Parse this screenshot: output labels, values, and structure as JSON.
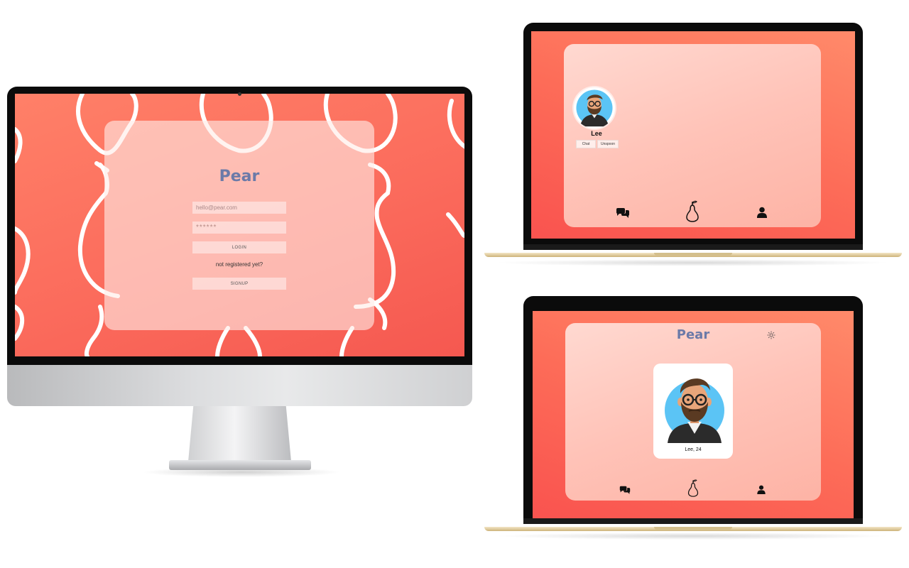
{
  "login_screen": {
    "app_title": "Pear",
    "email_placeholder": "hello@pear.com",
    "password_masked": "******",
    "login_label": "LOGIN",
    "note": "not registered yet?",
    "signup_label": "SIGNUP"
  },
  "matches_screen": {
    "match": {
      "name": "Lee"
    },
    "chat_label": "Chat",
    "unspoon_label": "Unspoon"
  },
  "home_screen": {
    "app_title": "Pear",
    "profile_caption": "Lee, 24"
  },
  "nav_icons": [
    "chat-bubbles-icon",
    "pear-icon",
    "user-icon",
    "gear-icon"
  ],
  "colors": {
    "accent": "#fb6b5c",
    "brand_text": "#6b7aa8",
    "panel": "#ffd0c6",
    "avatar_bg": "#5bc4f5"
  }
}
